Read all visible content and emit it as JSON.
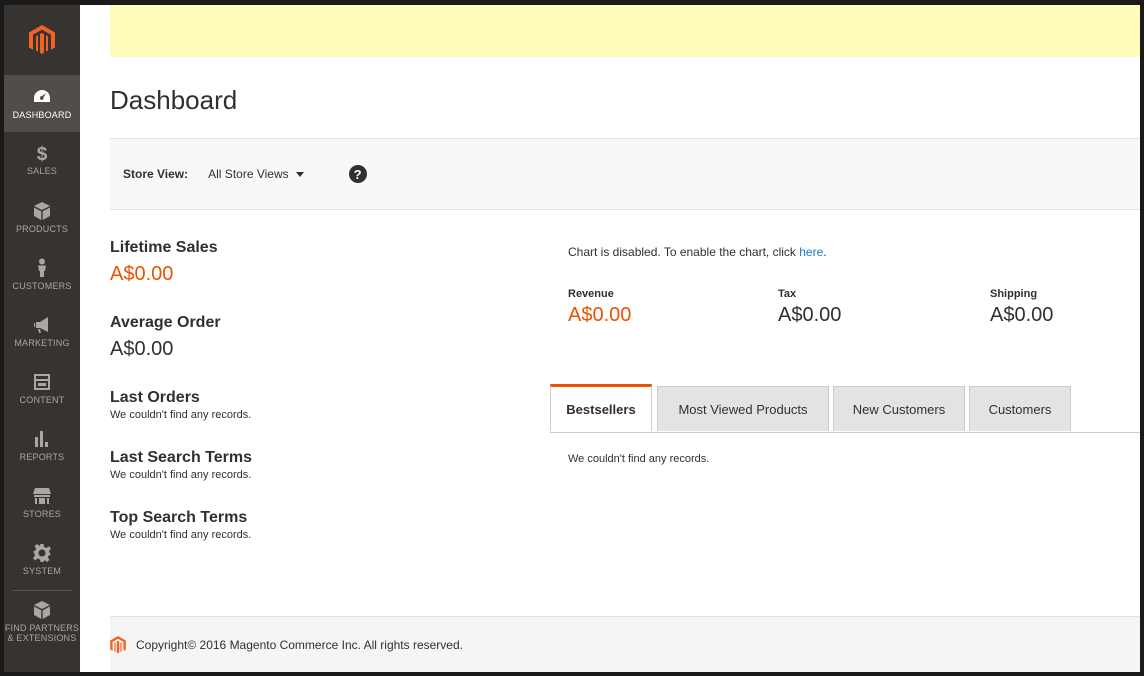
{
  "sidebar": {
    "items": [
      {
        "label": "DASHBOARD",
        "icon": "dashboard-gauge-icon"
      },
      {
        "label": "SALES",
        "icon": "dollar-icon",
        "glyph": "$"
      },
      {
        "label": "PRODUCTS",
        "icon": "cube-icon"
      },
      {
        "label": "CUSTOMERS",
        "icon": "person-icon"
      },
      {
        "label": "MARKETING",
        "icon": "megaphone-icon"
      },
      {
        "label": "CONTENT",
        "icon": "layout-icon"
      },
      {
        "label": "REPORTS",
        "icon": "bar-chart-icon"
      },
      {
        "label": "STORES",
        "icon": "storefront-icon"
      },
      {
        "label": "SYSTEM",
        "icon": "gear-icon"
      }
    ],
    "partners_label_line1": "FIND PARTNERS",
    "partners_label_line2": "& EXTENSIONS"
  },
  "page": {
    "title": "Dashboard"
  },
  "store_view": {
    "label": "Store View:",
    "value": "All Store Views",
    "help": "?"
  },
  "left": {
    "lifetime_sales_title": "Lifetime Sales",
    "lifetime_sales_value": "A$0.00",
    "average_order_title": "Average Order",
    "average_order_value": "A$0.00",
    "last_orders_title": "Last Orders",
    "last_orders_empty": "We couldn't find any records.",
    "last_search_title": "Last Search Terms",
    "last_search_empty": "We couldn't find any records.",
    "top_search_title": "Top Search Terms",
    "top_search_empty": "We couldn't find any records."
  },
  "chart": {
    "message": "Chart is disabled. To enable the chart, click ",
    "link": "here",
    "period": "."
  },
  "totals": [
    {
      "label": "Revenue",
      "value": "A$0.00"
    },
    {
      "label": "Tax",
      "value": "A$0.00"
    },
    {
      "label": "Shipping",
      "value": "A$0.00"
    }
  ],
  "tabs": [
    {
      "label": "Bestsellers"
    },
    {
      "label": "Most Viewed Products"
    },
    {
      "label": "New Customers"
    },
    {
      "label": "Customers"
    }
  ],
  "tab_content": "We couldn't find any records.",
  "footer": {
    "copyright": "Copyright© 2016 Magento Commerce Inc. All rights reserved."
  },
  "colors": {
    "accent": "#eb5202",
    "sidebar": "#373330",
    "notice": "#fffbbb",
    "link": "#1979c3"
  }
}
